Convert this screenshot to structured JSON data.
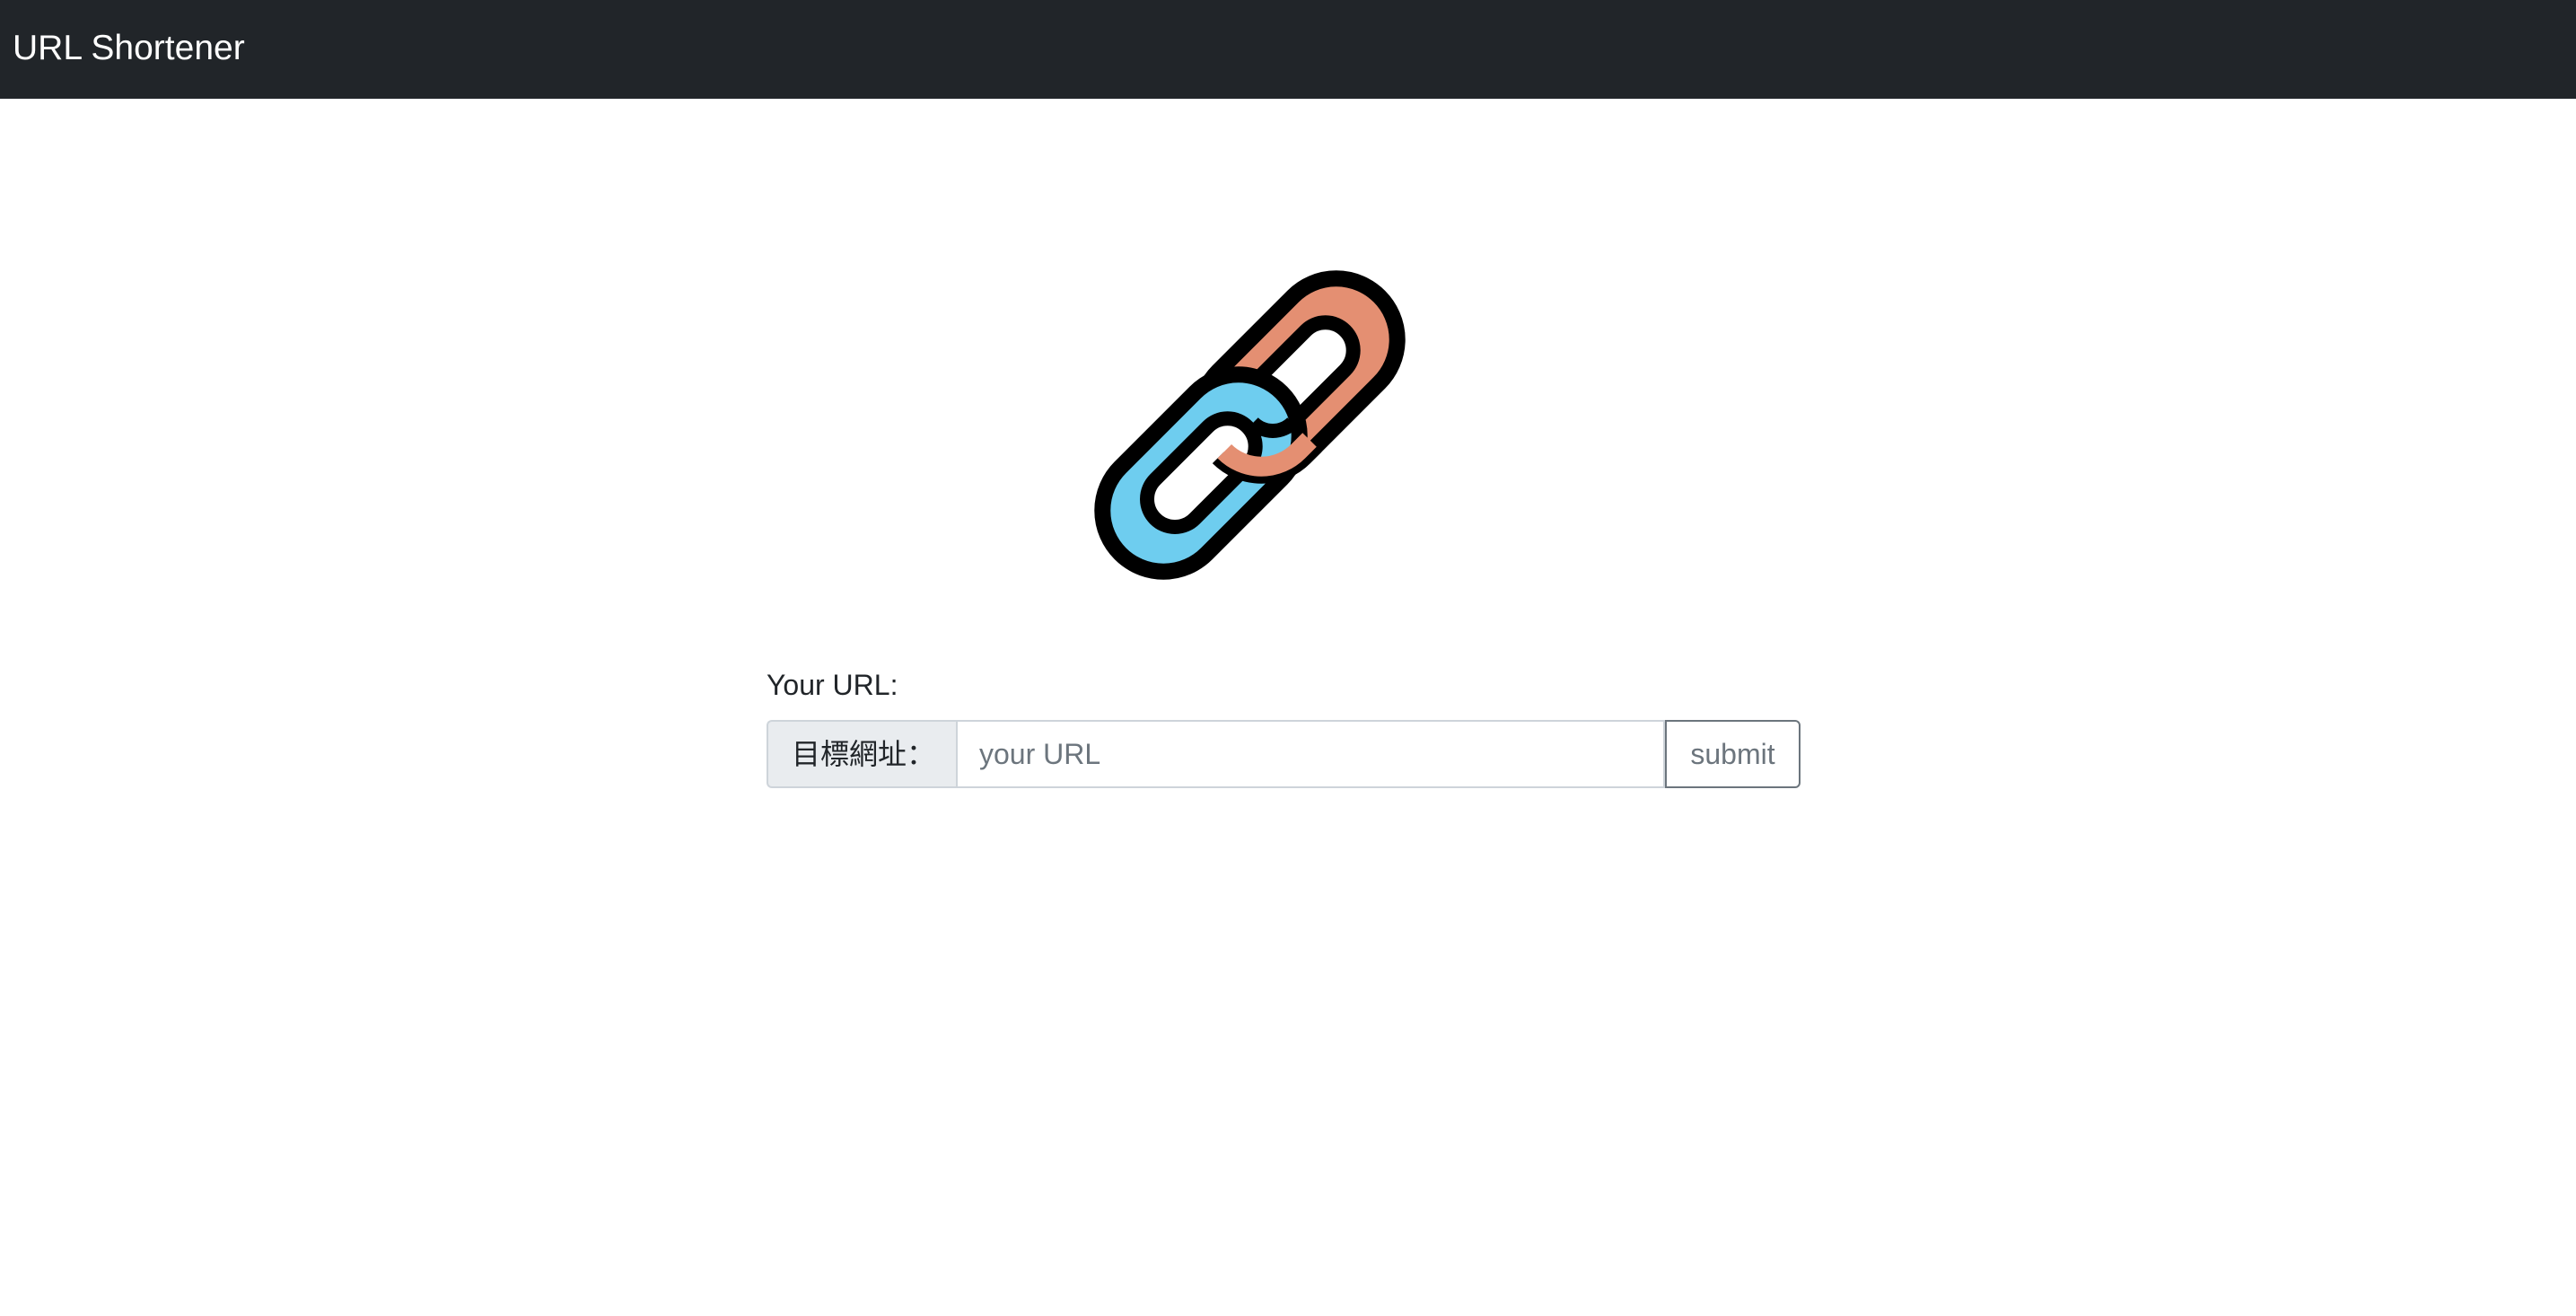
{
  "navbar": {
    "brand": "URL Shortener"
  },
  "logo": {
    "icon": "link-chain-icon",
    "colors": {
      "link_back": "#E48F72",
      "link_front": "#6ECDEF",
      "outline": "#000000"
    }
  },
  "form": {
    "label": "Your URL:",
    "addon": "目標網址：",
    "input_placeholder": "your URL",
    "input_value": "",
    "submit_label": "submit"
  },
  "colors": {
    "navbar_bg": "#212529",
    "addon_bg": "#E9ECEF",
    "button_border": "#6C757D"
  }
}
